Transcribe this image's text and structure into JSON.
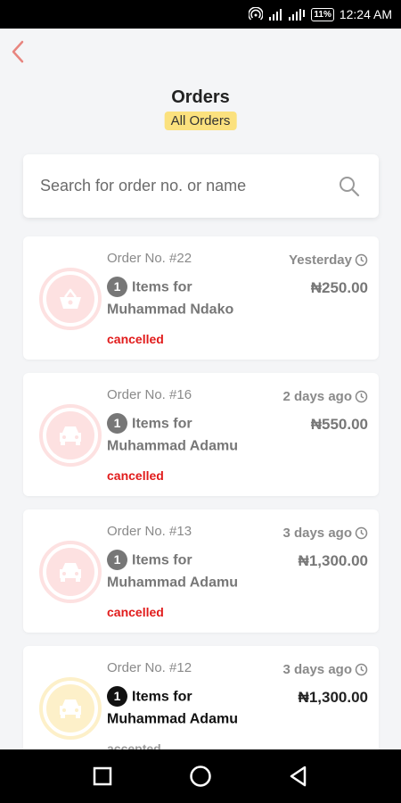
{
  "status_bar": {
    "time": "12:24 AM",
    "battery": "11%"
  },
  "header": {
    "title": "Orders",
    "filter": "All Orders"
  },
  "search": {
    "placeholder": "Search for order no. or name"
  },
  "orders": [
    {
      "number": "Order No. #22",
      "count": "1",
      "items_text": "Items for",
      "customer": "Muhammad Ndako",
      "date": "Yesterday",
      "price": "₦250.00",
      "status": "cancelled",
      "icon": "basket-icon"
    },
    {
      "number": "Order No. #16",
      "count": "1",
      "items_text": "Items for",
      "customer": "Muhammad Adamu",
      "date": "2 days ago",
      "price": "₦550.00",
      "status": "cancelled",
      "icon": "car-icon"
    },
    {
      "number": "Order No. #13",
      "count": "1",
      "items_text": "Items for",
      "customer": "Muhammad Adamu",
      "date": "3 days ago",
      "price": "₦1,300.00",
      "status": "cancelled",
      "icon": "car-icon"
    },
    {
      "number": "Order No. #12",
      "count": "1",
      "items_text": "Items for",
      "customer": "Muhammad Adamu",
      "date": "3 days ago",
      "price": "₦1,300.00",
      "status": "accepted",
      "icon": "car-icon"
    }
  ],
  "colors": {
    "accent": "#e8857f",
    "cancelled": "#e11b1b",
    "badge": "#fbe17e"
  }
}
